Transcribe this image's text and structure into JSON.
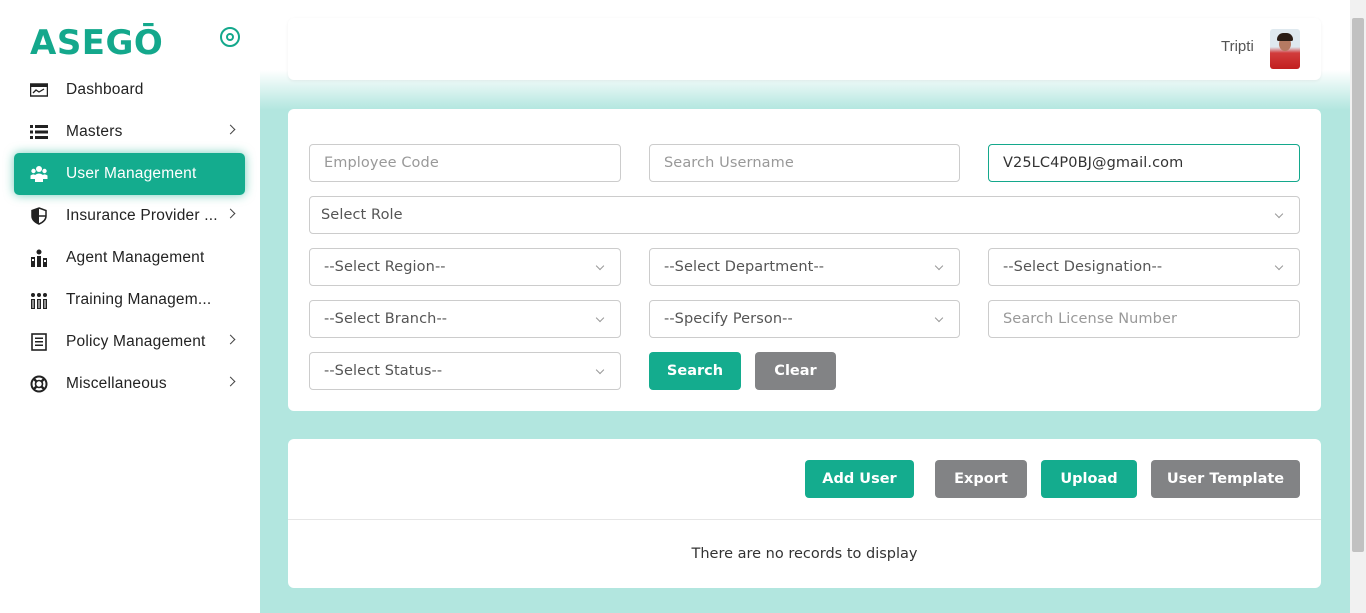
{
  "brand": {
    "logo": "ASEGŌ",
    "accent": "#14ac8e"
  },
  "sidebar": {
    "items": [
      {
        "label": "Dashboard",
        "icon": "dashboard-icon",
        "chevron": false
      },
      {
        "label": "Masters",
        "icon": "list-icon",
        "chevron": true
      },
      {
        "label": "User Management",
        "icon": "users-icon",
        "chevron": false,
        "active": true
      },
      {
        "label": "Insurance Provider ...",
        "icon": "shield-icon",
        "chevron": true
      },
      {
        "label": "Agent Management",
        "icon": "agent-icon",
        "chevron": false
      },
      {
        "label": "Training Managem...",
        "icon": "training-icon",
        "chevron": false
      },
      {
        "label": "Policy Management",
        "icon": "policy-icon",
        "chevron": true
      },
      {
        "label": "Miscellaneous",
        "icon": "lifebuoy-icon",
        "chevron": true
      }
    ]
  },
  "header": {
    "username": "Tripti"
  },
  "filters": {
    "employee_code": {
      "placeholder": "Employee Code",
      "value": ""
    },
    "search_username": {
      "placeholder": "Search Username",
      "value": ""
    },
    "email": {
      "value": "V25LC4P0BJ@gmail.com"
    },
    "role": "Select Role",
    "region": "--Select Region--",
    "department": "--Select Department--",
    "designation": "--Select Designation--",
    "branch": "--Select Branch--",
    "person": "--Specify Person--",
    "license": {
      "placeholder": "Search License Number",
      "value": ""
    },
    "status": "--Select Status--",
    "search_label": "Search",
    "clear_label": "Clear"
  },
  "actions": {
    "add_user": "Add User",
    "export": "Export",
    "upload": "Upload",
    "user_template": "User Template"
  },
  "table": {
    "empty_message": "There are no records to display"
  }
}
